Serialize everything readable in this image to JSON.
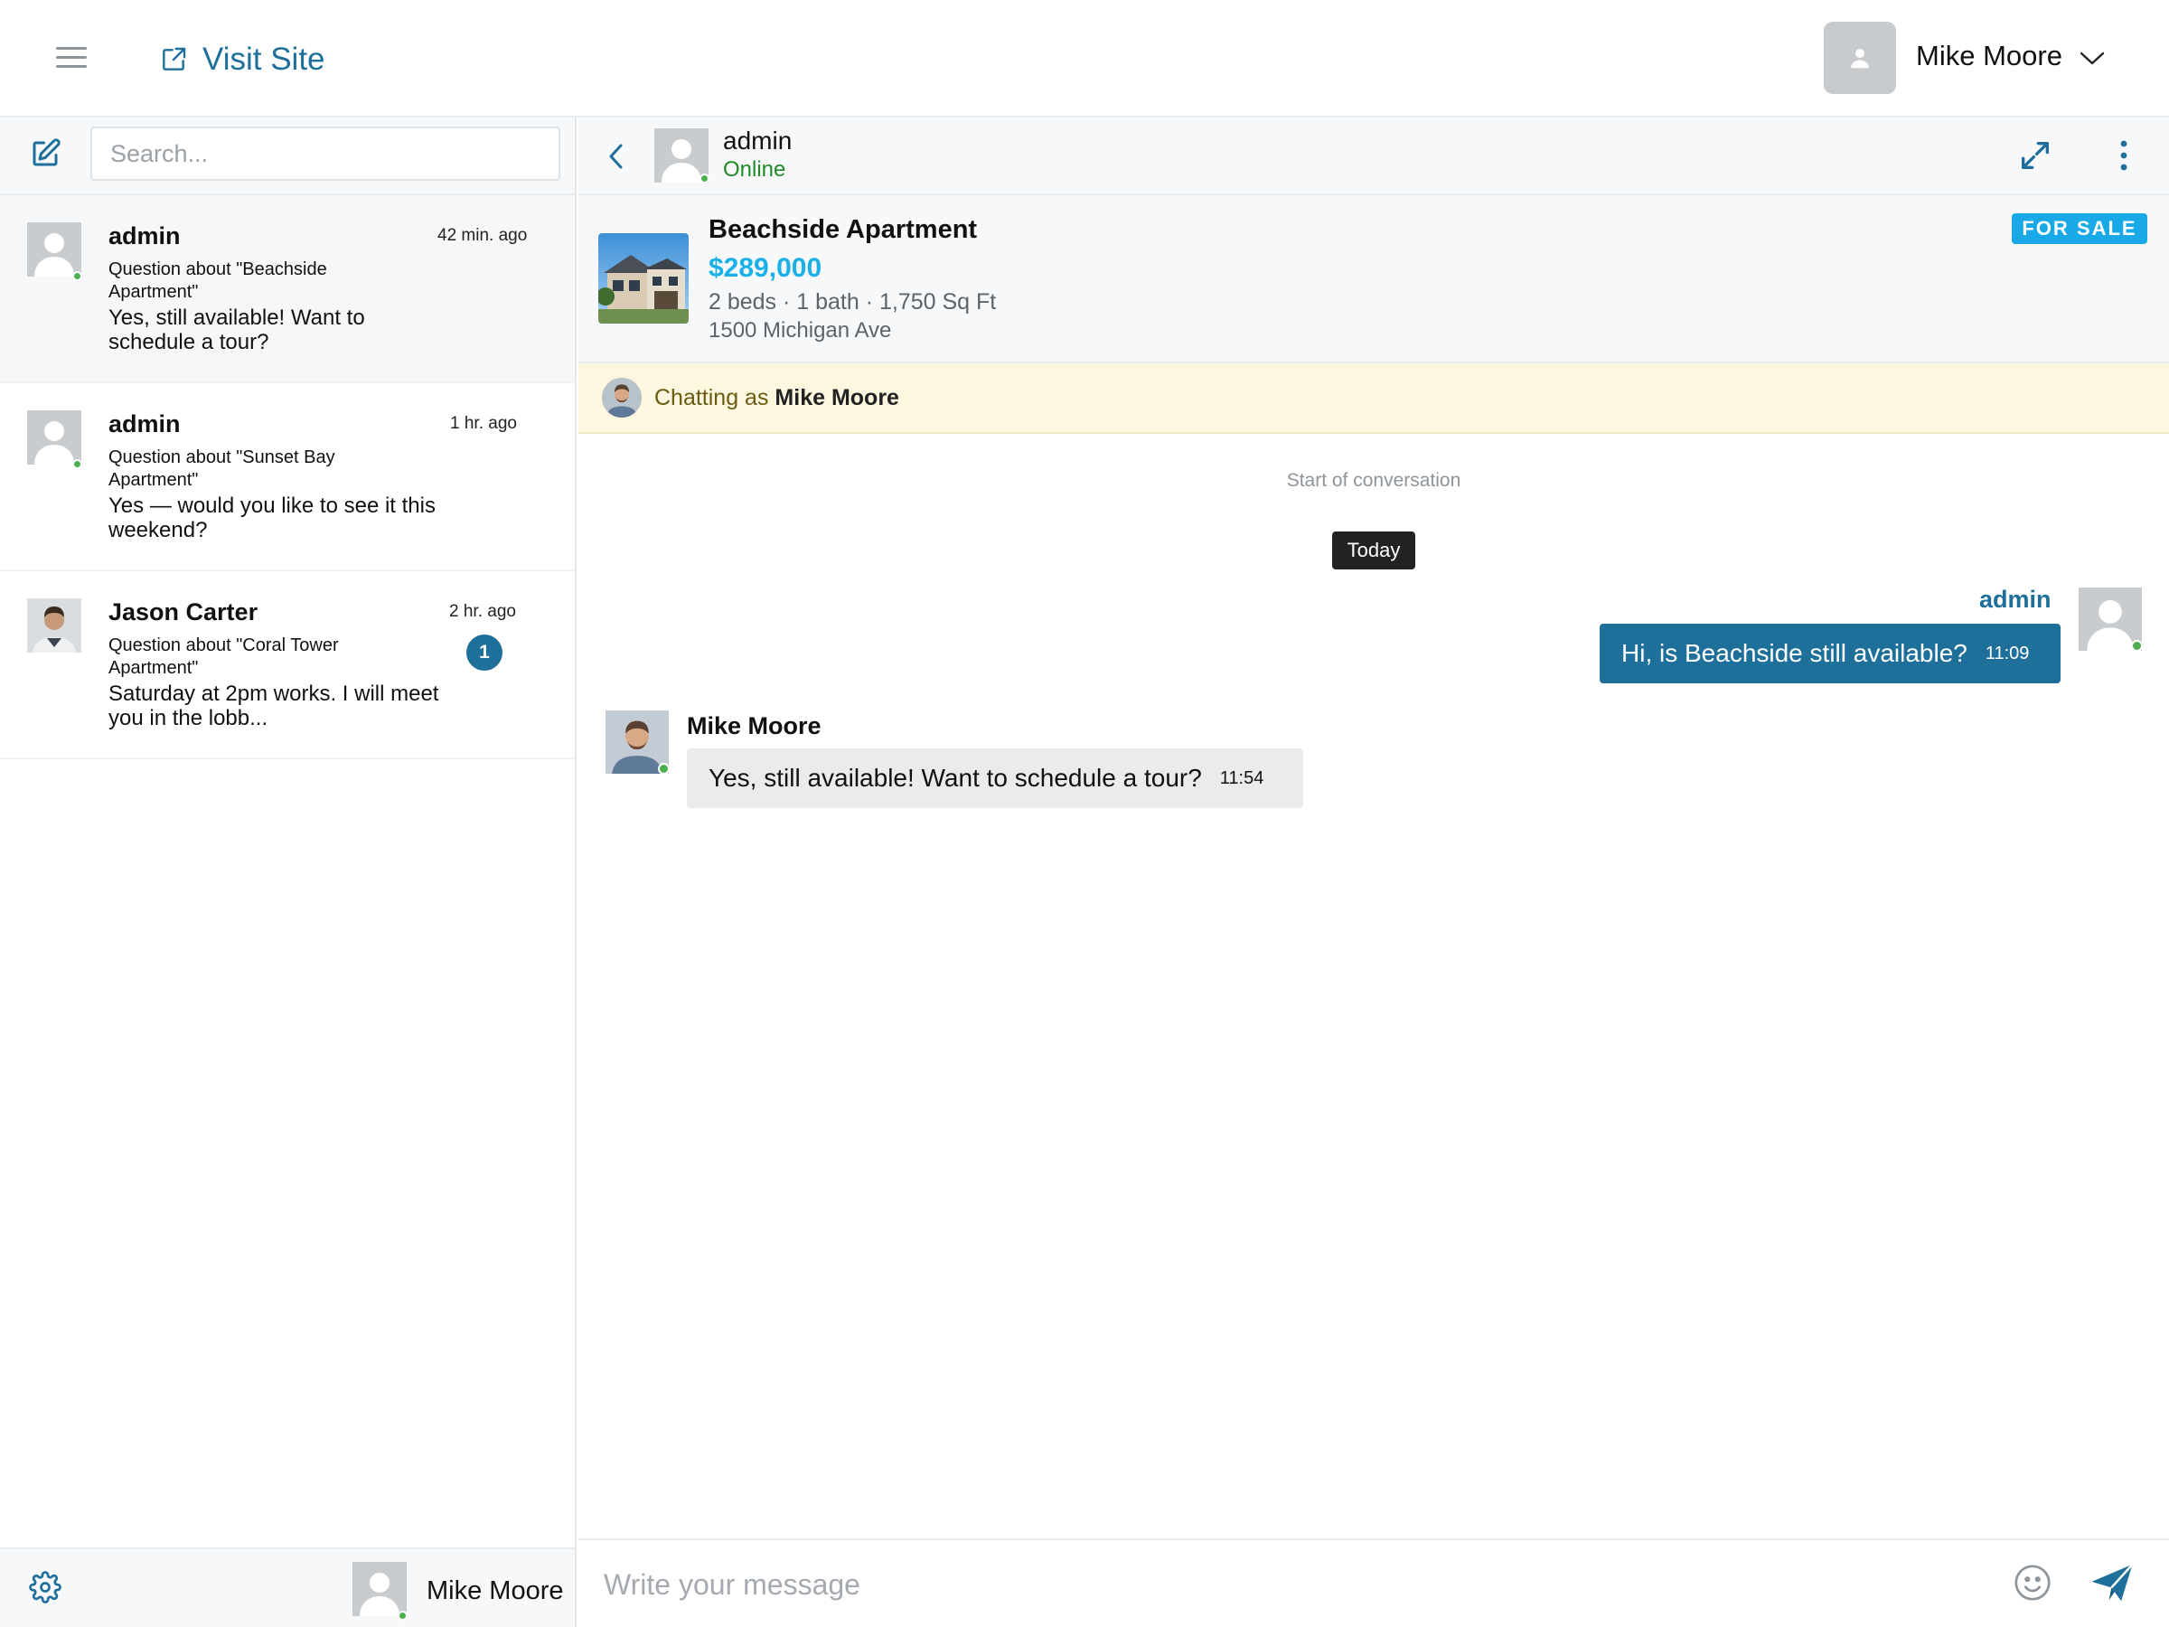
{
  "header": {
    "visit_site": "Visit Site",
    "user_name": "Mike Moore"
  },
  "sidebar": {
    "search_placeholder": "Search...",
    "conversations": [
      {
        "name": "admin",
        "time": "42 min. ago",
        "subject": "Question about \"Beachside Apartment\"",
        "last_message": "Yes, still available! Want to schedule a tour?",
        "unread": ""
      },
      {
        "name": "admin",
        "time": "1 hr. ago",
        "subject": "Question about \"Sunset Bay Apartment\"",
        "last_message": "Yes — would you like to see it this weekend?",
        "unread": ""
      },
      {
        "name": "Jason Carter",
        "time": "2 hr. ago",
        "subject": "Question about \"Coral Tower Apartment\"",
        "last_message": "Saturday at 2pm works. I will meet you in the lobb...",
        "unread": "1"
      }
    ],
    "footer_user": "Mike Moore"
  },
  "chat": {
    "contact_name": "admin",
    "contact_status": "Online",
    "listing": {
      "title": "Beachside Apartment",
      "price": "$289,000",
      "specs": "2 beds · 1 bath · 1,750 Sq Ft",
      "address": "1500 Michigan Ave",
      "tag": "FOR SALE"
    },
    "chatting_as_prefix": "Chatting as",
    "chatting_as_name": "Mike Moore",
    "start_label": "Start of conversation",
    "date_label": "Today",
    "messages": [
      {
        "sender": "admin",
        "text": "Hi, is Beachside still available?",
        "time": "11:09"
      },
      {
        "sender": "Mike Moore",
        "text": "Yes, still available! Want to schedule a tour?",
        "time": "11:54"
      }
    ],
    "composer_placeholder": "Write your message"
  },
  "colors": {
    "primary": "#1e6f9a",
    "price": "#1ab0e8",
    "sale_tag": "#19a9e6",
    "online": "#4caf50",
    "chatting_bg": "#fdf7e0"
  },
  "icons": {
    "menu": "hamburger-icon",
    "visit": "external-link-icon",
    "compose": "edit-icon",
    "settings": "gear-icon",
    "back": "chevron-left-icon",
    "expand": "expand-icon",
    "more": "kebab-icon",
    "emoji": "smiley-icon",
    "send": "paper-plane-icon"
  }
}
